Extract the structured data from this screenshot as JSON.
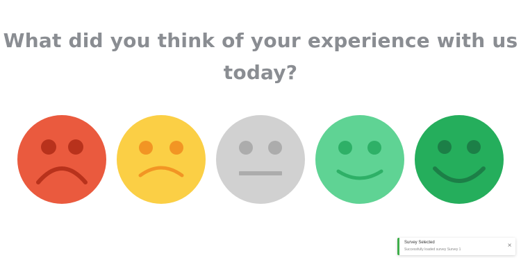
{
  "survey": {
    "question": "What did you think of your experience with us today?",
    "options": [
      {
        "icon": "very-sad-face-icon",
        "face_color": "#ea5a3e",
        "feature_color": "#b8321c"
      },
      {
        "icon": "sad-face-icon",
        "face_color": "#fbcf45",
        "feature_color": "#f29524"
      },
      {
        "icon": "neutral-face-icon",
        "face_color": "#d1d1d1",
        "feature_color": "#acacac"
      },
      {
        "icon": "happy-face-icon",
        "face_color": "#5fd394",
        "feature_color": "#2eb067"
      },
      {
        "icon": "very-happy-face-icon",
        "face_color": "#25ae5c",
        "feature_color": "#1c7f47"
      }
    ]
  },
  "toast": {
    "title": "Survey Selected",
    "message": "Successfully loaded survey Survey 1",
    "close_icon": "close-icon",
    "accent_color": "#3fae4a"
  }
}
